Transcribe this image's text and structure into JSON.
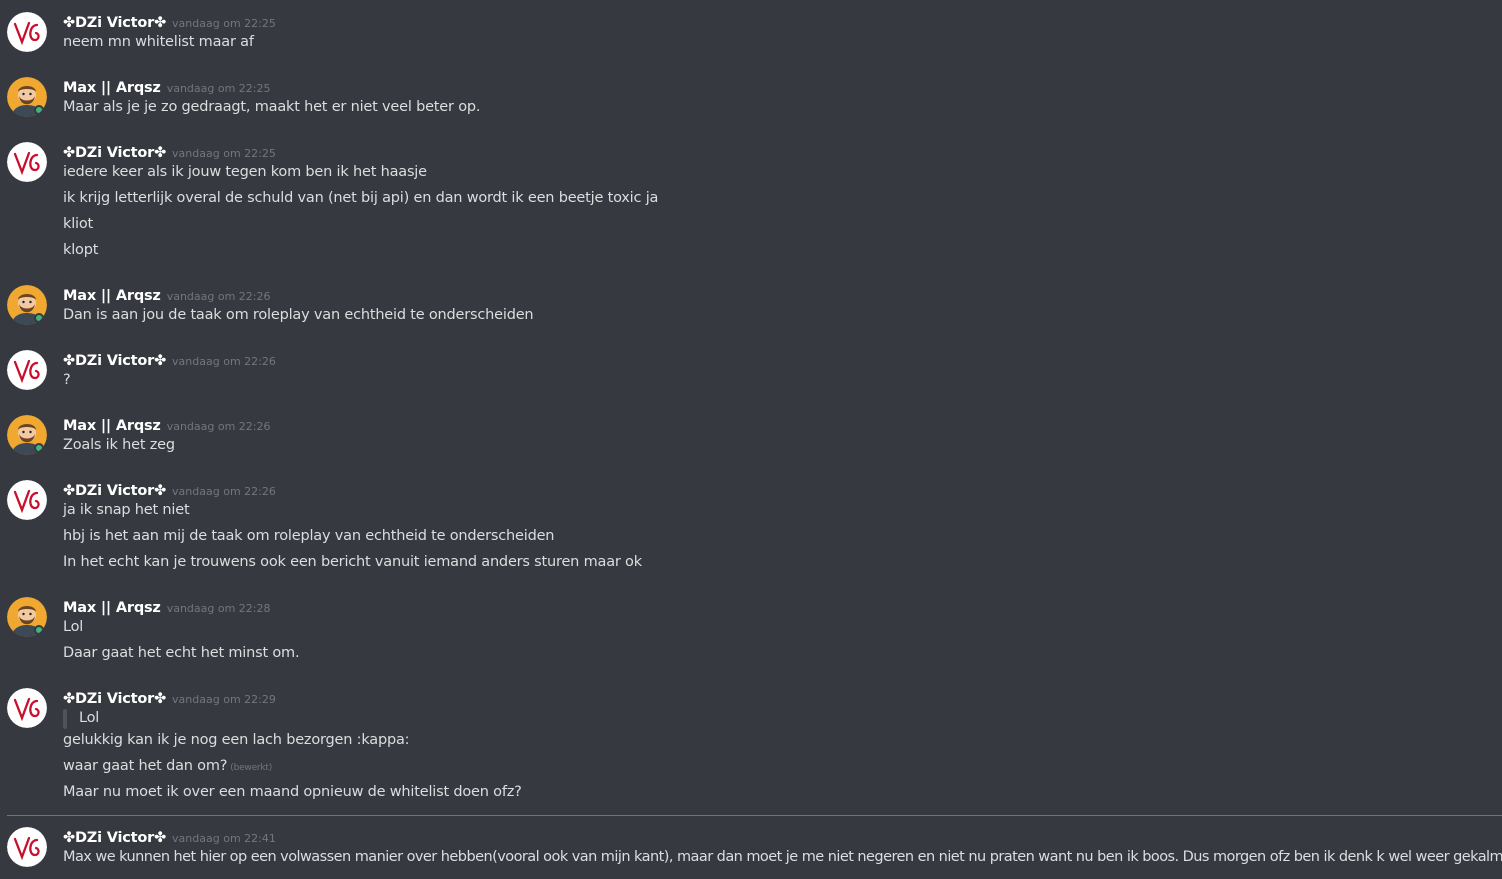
{
  "users": {
    "victor": {
      "name": "✤DZi Victor✤",
      "avatar_icon": "vg-logo-icon",
      "avatar_bg": "#ffffff",
      "logo_color": "#c8102e"
    },
    "max": {
      "name": "Max || Arqsz",
      "avatar_icon": "bearded-man-icon",
      "avatar_bg": "#f0a830"
    }
  },
  "messages": [
    {
      "author": "✤DZi Victor✤",
      "timestamp": "vandaag om 22:25",
      "lines": [
        "neem mn whitelist maar af"
      ]
    },
    {
      "author": "Max || Arqsz",
      "timestamp": "vandaag om 22:25",
      "lines": [
        "Maar als je je zo gedraagt, maakt het er niet veel beter op."
      ]
    },
    {
      "author": "✤DZi Victor✤",
      "timestamp": "vandaag om 22:25",
      "lines": [
        "iedere keer als ik jouw tegen kom ben ik het haasje",
        "ik krijg letterlijk overal de schuld van (net bij api) en dan wordt ik een beetje toxic ja",
        "kliot",
        "klopt"
      ]
    },
    {
      "author": "Max || Arqsz",
      "timestamp": "vandaag om 22:26",
      "lines": [
        "Dan is aan jou de taak om roleplay van echtheid te onderscheiden"
      ]
    },
    {
      "author": "✤DZi Victor✤",
      "timestamp": "vandaag om 22:26",
      "lines": [
        "?"
      ]
    },
    {
      "author": "Max || Arqsz",
      "timestamp": "vandaag om 22:26",
      "lines": [
        "Zoals ik het zeg"
      ]
    },
    {
      "author": "✤DZi Victor✤",
      "timestamp": "vandaag om 22:26",
      "lines": [
        "ja ik snap het niet",
        "hbj is het aan mij de taak om roleplay van echtheid te onderscheiden",
        "In het echt kan je trouwens ook een bericht vanuit iemand anders sturen maar ok"
      ]
    },
    {
      "author": "Max || Arqsz",
      "timestamp": "vandaag om 22:28",
      "lines": [
        "Lol",
        "Daar gaat het echt het minst om."
      ]
    },
    {
      "author": "✤DZi Victor✤",
      "timestamp": "vandaag om 22:29",
      "quote": "Lol",
      "lines": [
        "gelukkig kan ik je nog een lach bezorgen :kappa:",
        "waar gaat het dan om?",
        "Maar nu moet ik over een maand opnieuw de whitelist doen ofz?"
      ],
      "edited_label": "(bewerkt)"
    },
    {
      "author": "✤DZi Victor✤",
      "timestamp": "vandaag om 22:41",
      "lines": [
        "Max we kunnen het hier op een volwassen manier over hebben(vooral ook van mijn kant), maar dan moet je me niet negeren en niet nu praten want nu ben ik boos. Dus morgen ofz ben ik denk k wel weer gekalmeerd...."
      ]
    }
  ],
  "divider_color": "#e0454b"
}
